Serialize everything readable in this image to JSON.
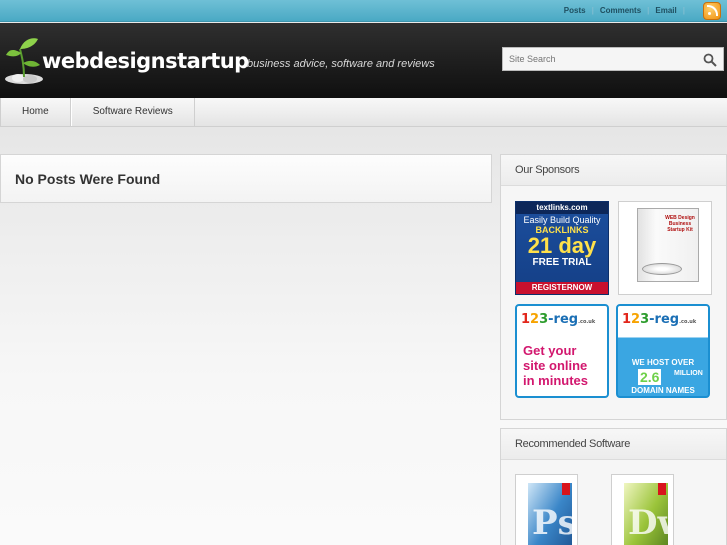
{
  "topbar": {
    "links": [
      "Posts",
      "Comments",
      "Email"
    ],
    "rss_icon": "rss-icon"
  },
  "header": {
    "logo_text": "webdesignstartup",
    "tagline": "business advice, software and reviews",
    "search_placeholder": "Site Search"
  },
  "nav": {
    "items": [
      "Home",
      "Software Reviews"
    ]
  },
  "main": {
    "message": "No Posts Were Found"
  },
  "sidebar": {
    "sponsors_title": "Our Sponsors",
    "ad_textlinks": {
      "brand": "textlinks.com",
      "line1": "Easily Build Quality",
      "line2": "BACKLINKS",
      "days": "21 day",
      "line3": "FREE TRIAL",
      "cta": "REGISTERNOW"
    },
    "ad_box": {
      "label": "WEB Design Business Startup Kit"
    },
    "ad_reg1": {
      "logo": "123-reg",
      "domain": ".co.uk",
      "text": [
        "Get your",
        "site online",
        "in minutes"
      ]
    },
    "ad_reg2": {
      "logo": "123-reg",
      "domain": ".co.uk",
      "line1": "WE HOST OVER",
      "big": "2.6",
      "million": "MILLION",
      "line2": "DOMAIN NAMES"
    },
    "software_title": "Recommended Software",
    "software": [
      {
        "name": "Photoshop",
        "letter": "Ps"
      },
      {
        "name": "Dreamweaver",
        "letter": "Dw"
      }
    ]
  },
  "colors": {
    "topbar": "#4aa9c4",
    "header": "#111111",
    "accent_pink": "#d2176e"
  }
}
